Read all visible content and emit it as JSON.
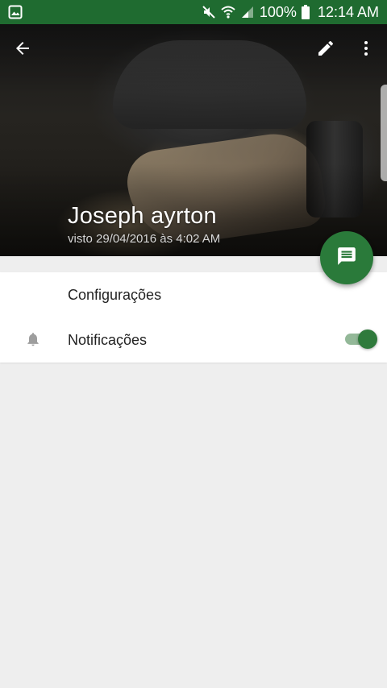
{
  "status_bar": {
    "battery": "100%",
    "time": "12:14 AM",
    "icons": [
      "image-notification-icon",
      "mute-icon",
      "wifi-icon",
      "signal-icon",
      "battery-icon"
    ]
  },
  "header": {
    "name": "Joseph ayrton",
    "last_seen": "visto 29/04/2016 às 4:02 AM",
    "icons": [
      "back-arrow-icon",
      "edit-pencil-icon",
      "more-vert-icon"
    ]
  },
  "fab": {
    "icon": "message-icon"
  },
  "settings": {
    "title": "Configurações",
    "notifications": {
      "label": "Notificações",
      "icon": "bell-icon",
      "enabled": true
    }
  },
  "colors": {
    "status_bar": "#1f6b30",
    "accent": "#2a7a3a",
    "toggle_track": "#93b898",
    "background": "#eeeeee"
  }
}
